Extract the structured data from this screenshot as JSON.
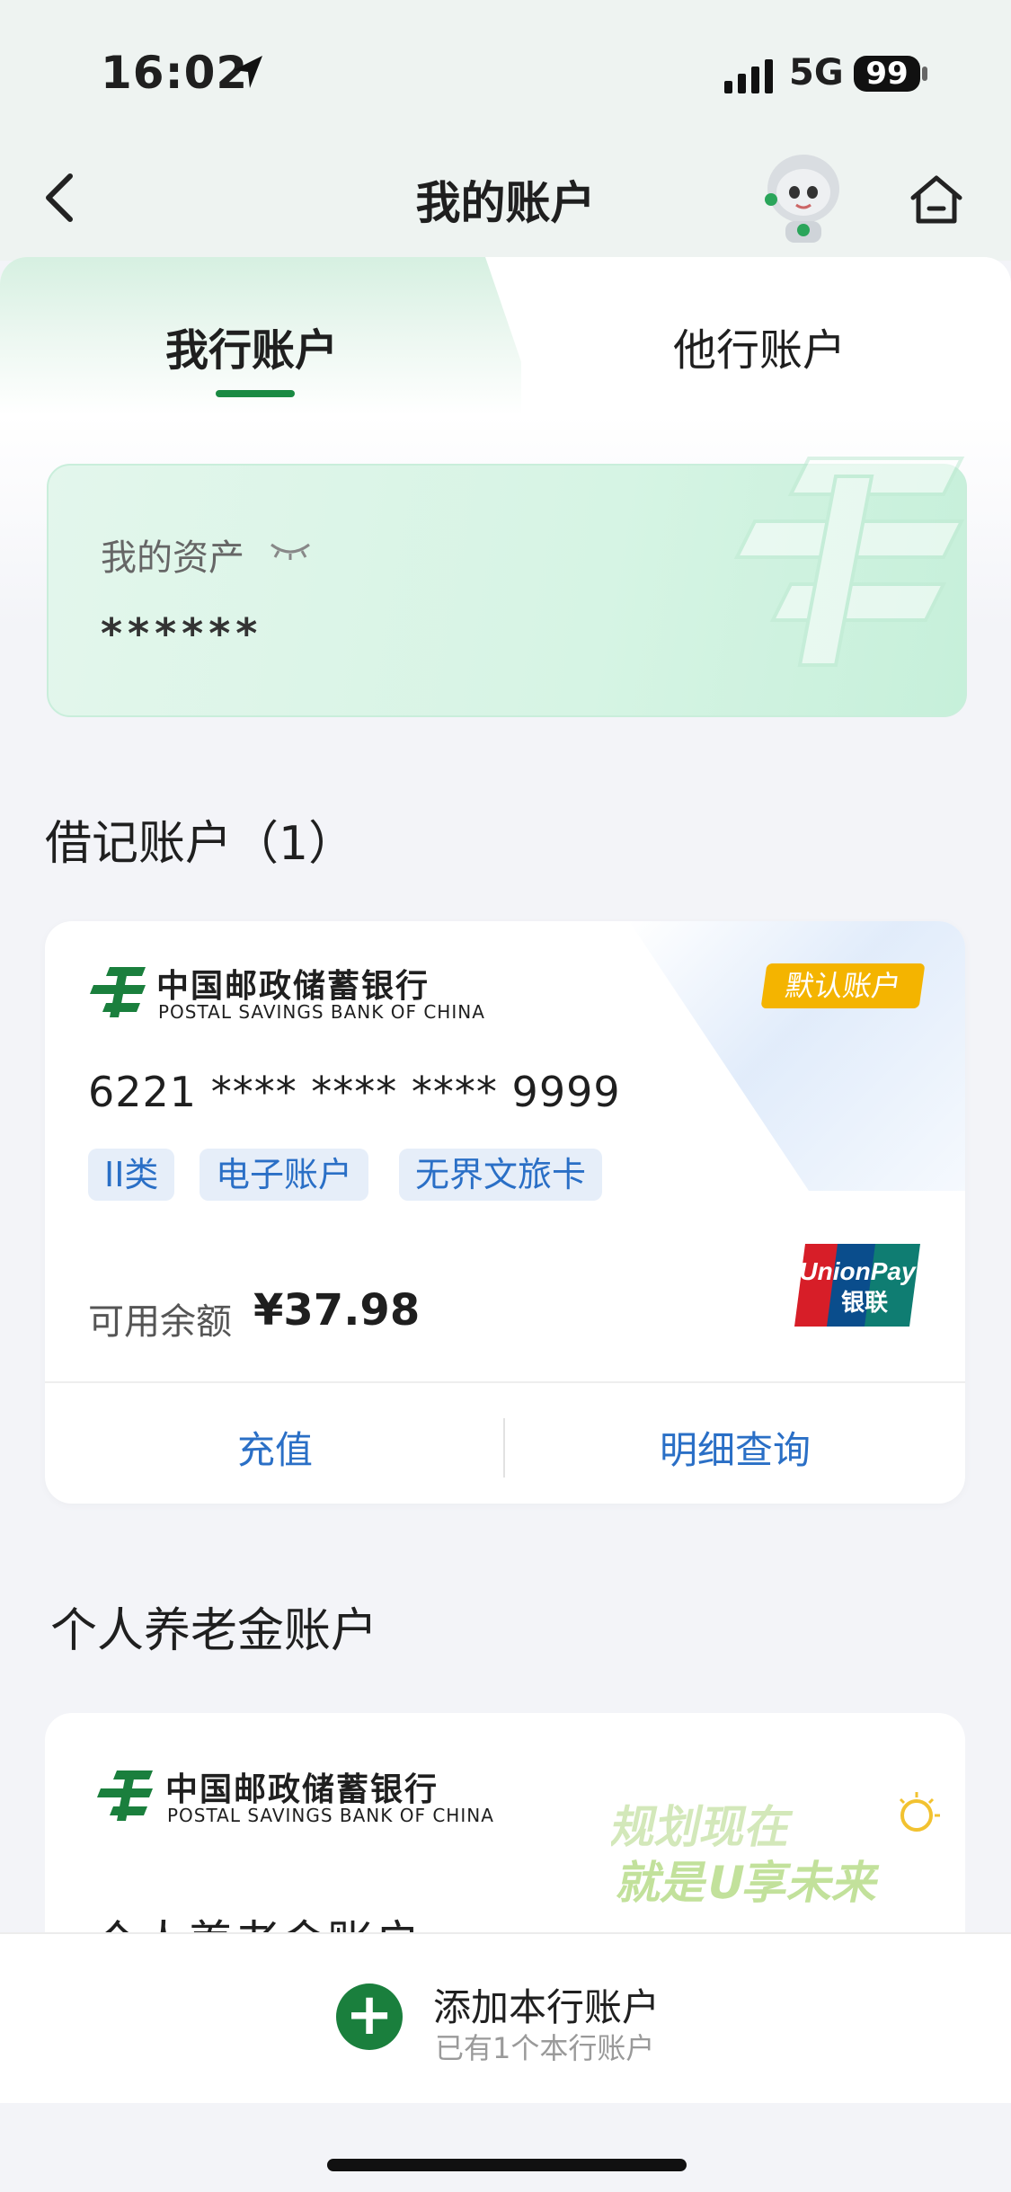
{
  "status_bar": {
    "time": "16:02",
    "network": "5G",
    "battery": "99"
  },
  "header": {
    "title": "我的账户"
  },
  "tabs": [
    {
      "label": "我行账户",
      "active": true
    },
    {
      "label": "他行账户",
      "active": false
    }
  ],
  "assets": {
    "label": "我的资产",
    "value": "******"
  },
  "debit_section": {
    "title": "借记账户（1）"
  },
  "debit_card": {
    "bank_name_cn": "中国邮政储蓄银行",
    "bank_name_en": "POSTAL SAVINGS BANK OF CHINA",
    "default_badge": "默认账户",
    "card_number": "6221 **** **** **** 9999",
    "tags": [
      "II类",
      "电子账户",
      "无界文旅卡"
    ],
    "available_label": "可用余额",
    "available_value": "¥37.98",
    "actions": [
      "充值",
      "明细查询"
    ]
  },
  "pension_section": {
    "title": "个人养老金账户"
  },
  "pension_card": {
    "bank_name_cn": "中国邮政储蓄银行",
    "bank_name_en": "POSTAL SAVINGS BANK OF CHINA",
    "title": "个人养老金账户",
    "promo_line1": "规划现在",
    "promo_line2": "就是U享未来"
  },
  "bottom_bar": {
    "add_title": "添加本行账户",
    "add_subtitle": "已有1个本行账户"
  },
  "colors": {
    "brand_green": "#1a7f3d",
    "link_blue": "#2a6fc6",
    "badge_orange": "#f4b400"
  }
}
